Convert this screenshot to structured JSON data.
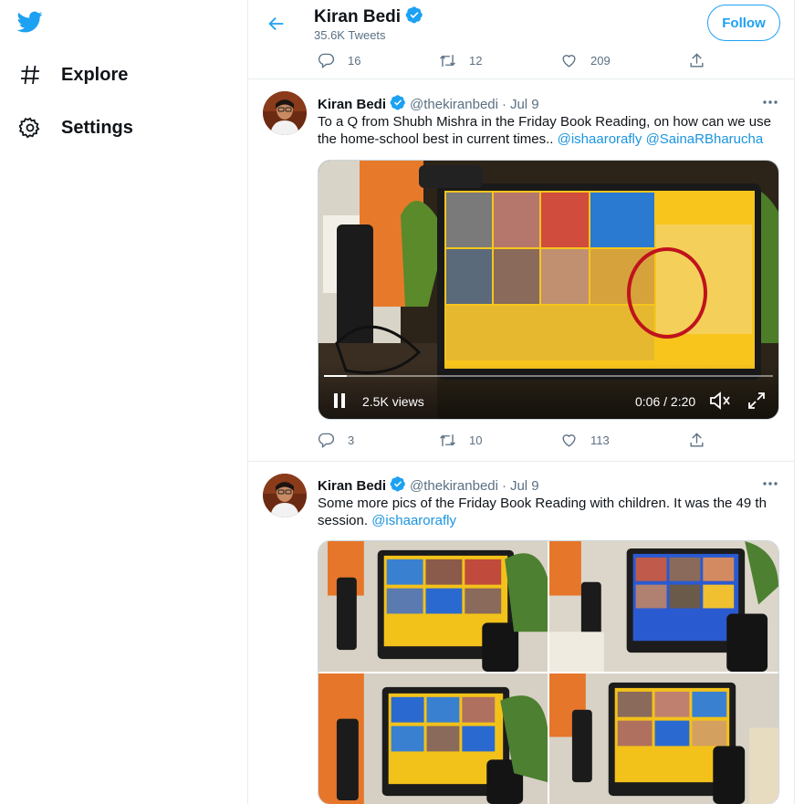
{
  "nav": {
    "logo_icon": "twitter-bird-icon",
    "explore_label": "Explore",
    "settings_label": "Settings"
  },
  "header": {
    "name": "Kiran Bedi",
    "tweet_count": "35.6K Tweets",
    "follow_label": "Follow"
  },
  "top_tweet_actions": {
    "replies": "16",
    "retweets": "12",
    "likes": "209"
  },
  "tweets": [
    {
      "name": "Kiran Bedi",
      "handle": "@thekiranbedi",
      "date": "Jul 9",
      "text": "To a Q from Shubh Mishra in the Friday Book Reading, on how can we use the home-school best in current times..",
      "mentions": [
        "@ishaarorafly",
        "@SainaRBharucha"
      ],
      "media": {
        "type": "video",
        "views": "2.5K views",
        "time": "0:06 / 2:20",
        "progress": 0.05
      },
      "actions": {
        "replies": "3",
        "retweets": "10",
        "likes": "113"
      }
    },
    {
      "name": "Kiran Bedi",
      "handle": "@thekiranbedi",
      "date": "Jul 9",
      "text": "Some more pics of the Friday Book Reading with children. It was the 49 th session.",
      "mentions": [
        "@ishaarorafly"
      ],
      "media": {
        "type": "photo-grid",
        "count": 4
      }
    }
  ],
  "colors": {
    "brand": "#1da1f2",
    "link": "#1b95e0",
    "secondary_text": "#5b7083",
    "border": "#e6ecf0"
  }
}
